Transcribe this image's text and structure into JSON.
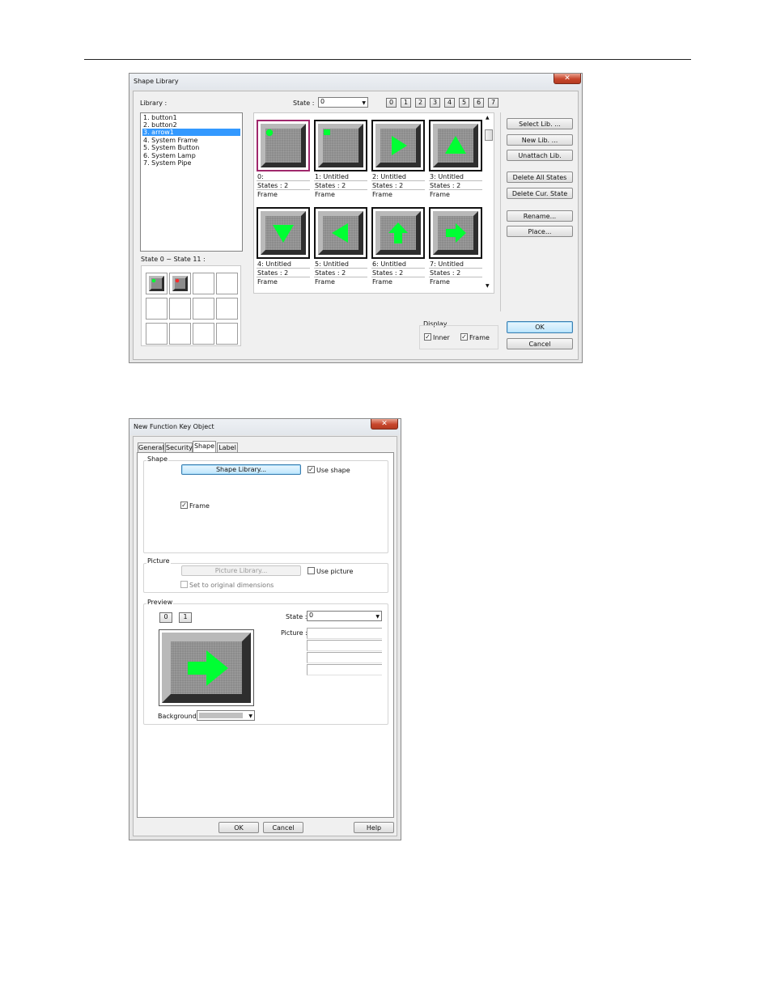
{
  "shape_library": {
    "title": "Shape Library",
    "close": "✕",
    "library_label": "Library :",
    "state_label": "State :",
    "state_value": "0",
    "state_buttons": [
      "0",
      "1",
      "2",
      "3",
      "4",
      "5",
      "6",
      "7"
    ],
    "libraries": [
      "1. button1",
      "2. button2",
      "3. arrow1",
      "4. System Frame",
      "5. System Button",
      "6. System Lamp",
      "7. System Pipe"
    ],
    "selected_library_index": 2,
    "states_range_label": "State 0 ~ State 11 :",
    "shapes": [
      {
        "name": "0:",
        "states": "States : 2",
        "frame": "Frame",
        "icon": "dot-icon",
        "selected": true
      },
      {
        "name": "1: Untitled",
        "states": "States : 2",
        "frame": "Frame",
        "icon": "small-square-icon"
      },
      {
        "name": "2: Untitled",
        "states": "States : 2",
        "frame": "Frame",
        "icon": "arrow-right-triangle-icon"
      },
      {
        "name": "3: Untitled",
        "states": "States : 2",
        "frame": "Frame",
        "icon": "arrow-up-triangle-icon"
      },
      {
        "name": "4: Untitled",
        "states": "States : 2",
        "frame": "Frame",
        "icon": "arrow-down-triangle-icon"
      },
      {
        "name": "5: Untitled",
        "states": "States : 2",
        "frame": "Frame",
        "icon": "arrow-left-triangle-icon"
      },
      {
        "name": "6: Untitled",
        "states": "States : 2",
        "frame": "Frame",
        "icon": "arrow-up-block-icon"
      },
      {
        "name": "7: Untitled",
        "states": "States : 2",
        "frame": "Frame",
        "icon": "arrow-right-block-icon"
      }
    ],
    "buttons": {
      "select_lib": "Select Lib. ...",
      "new_lib": "New Lib. ...",
      "unattach_lib": "Unattach Lib.",
      "delete_all_states": "Delete All States",
      "delete_cur_state": "Delete Cur. State",
      "rename": "Rename...",
      "place": "Place...",
      "ok": "OK",
      "cancel": "Cancel"
    },
    "display": {
      "label": "Display",
      "inner": "Inner",
      "frame": "Frame",
      "inner_checked": true,
      "frame_checked": true
    }
  },
  "function_key": {
    "title": "New  Function Key Object",
    "close": "✕",
    "tabs": [
      "General",
      "Security",
      "Shape",
      "Label"
    ],
    "active_tab": "Shape",
    "shape_group": "Shape",
    "shape_library_button": "Shape Library...",
    "use_shape": "Use shape",
    "use_shape_checked": true,
    "frame": "Frame",
    "frame_checked": true,
    "picture_group": "Picture",
    "picture_library_button": "Picture Library...",
    "use_picture": "Use picture",
    "use_picture_checked": false,
    "set_original": "Set to original dimensions",
    "preview_group": "Preview",
    "preview_states": [
      "0",
      "1"
    ],
    "state_label": "State :",
    "state_value": "0",
    "picture_label": "Picture :",
    "background_label": "Background :",
    "buttons": {
      "ok": "OK",
      "cancel": "Cancel",
      "help": "Help"
    }
  },
  "colors": {
    "arrow_green": "#00ff33",
    "selection_blue": "#3399ff",
    "close_red": "#c7462c"
  }
}
